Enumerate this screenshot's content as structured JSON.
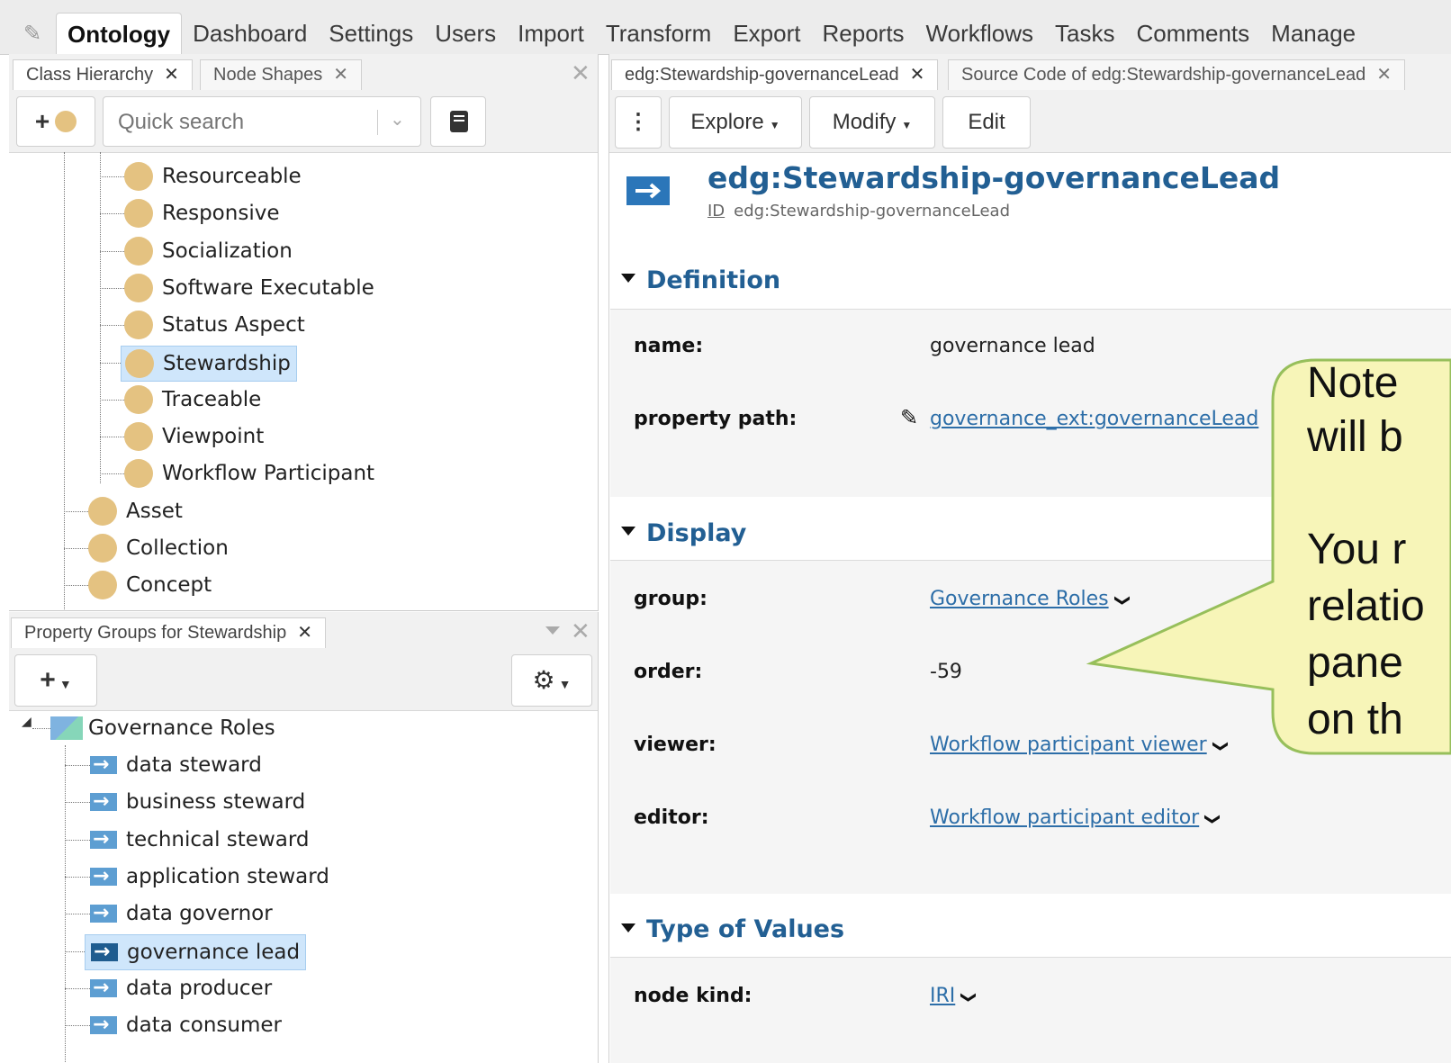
{
  "nav": {
    "tabs": [
      "Ontology",
      "Dashboard",
      "Settings",
      "Users",
      "Import",
      "Transform",
      "Export",
      "Reports",
      "Workflows",
      "Tasks",
      "Comments",
      "Manage"
    ]
  },
  "left_top": {
    "tabs": [
      {
        "label": "Class Hierarchy",
        "active": true
      },
      {
        "label": "Node Shapes",
        "active": false
      }
    ],
    "search": {
      "placeholder": "Quick search",
      "value": ""
    },
    "tree": [
      {
        "label": "Resourceable",
        "level": 2,
        "selected": false
      },
      {
        "label": "Responsive",
        "level": 2,
        "selected": false
      },
      {
        "label": "Socialization",
        "level": 2,
        "selected": false
      },
      {
        "label": "Software Executable",
        "level": 2,
        "selected": false
      },
      {
        "label": "Status Aspect",
        "level": 2,
        "selected": false
      },
      {
        "label": "Stewardship",
        "level": 2,
        "selected": true
      },
      {
        "label": "Traceable",
        "level": 2,
        "selected": false
      },
      {
        "label": "Viewpoint",
        "level": 2,
        "selected": false
      },
      {
        "label": "Workflow Participant",
        "level": 2,
        "selected": false
      },
      {
        "label": "Asset",
        "level": 1,
        "selected": false
      },
      {
        "label": "Collection",
        "level": 1,
        "selected": false
      },
      {
        "label": "Concept",
        "level": 1,
        "selected": false
      }
    ]
  },
  "left_bottom": {
    "tab_label": "Property Groups for Stewardship",
    "group": "Governance Roles",
    "items": [
      {
        "label": "data steward",
        "selected": false
      },
      {
        "label": "business steward",
        "selected": false
      },
      {
        "label": "technical steward",
        "selected": false
      },
      {
        "label": "application steward",
        "selected": false
      },
      {
        "label": "data governor",
        "selected": false
      },
      {
        "label": "governance lead",
        "selected": true
      },
      {
        "label": "data producer",
        "selected": false
      },
      {
        "label": "data consumer",
        "selected": false
      }
    ]
  },
  "right": {
    "tabs": [
      {
        "label": "edg:Stewardship-governanceLead",
        "active": true
      },
      {
        "label": "Source Code of edg:Stewardship-governanceLead",
        "active": false
      }
    ],
    "toolbar": {
      "explore": "Explore",
      "modify": "Modify",
      "edit": "Edit"
    },
    "title": "edg:Stewardship-governanceLead",
    "id_label": "ID",
    "id_value": "edg:Stewardship-governanceLead",
    "sections": {
      "definition": "Definition",
      "display": "Display",
      "type_of_values": "Type of Values"
    },
    "fields": {
      "name": {
        "label": "name:",
        "value": "governance lead"
      },
      "property_path": {
        "label": "property path:",
        "value": "governance_ext:governanceLead"
      },
      "group": {
        "label": "group:",
        "value": "Governance Roles"
      },
      "order": {
        "label": "order:",
        "value": "-59"
      },
      "viewer": {
        "label": "viewer:",
        "value": "Workflow participant viewer"
      },
      "editor": {
        "label": "editor:",
        "value": "Workflow participant editor"
      },
      "node_kind": {
        "label": "node kind:",
        "value": "IRI"
      }
    }
  },
  "callout": {
    "lines": [
      "Note",
      "will b",
      "",
      "You r",
      "relatio",
      "pane",
      "on th"
    ]
  },
  "colors": {
    "accent": "#225f93",
    "link": "#2d6ea8",
    "class_icon": "#e4c281",
    "property_icon": "#5d9ed2",
    "selection": "#cfe6fb",
    "callout": "#f7f5b8"
  },
  "icons": [
    "pencil-icon",
    "close-icon",
    "plus-icon",
    "class-icon",
    "chevron-down-icon",
    "book-icon",
    "kebab-menu-icon",
    "property-icon",
    "gear-icon",
    "caret-down-icon",
    "group-icon"
  ]
}
